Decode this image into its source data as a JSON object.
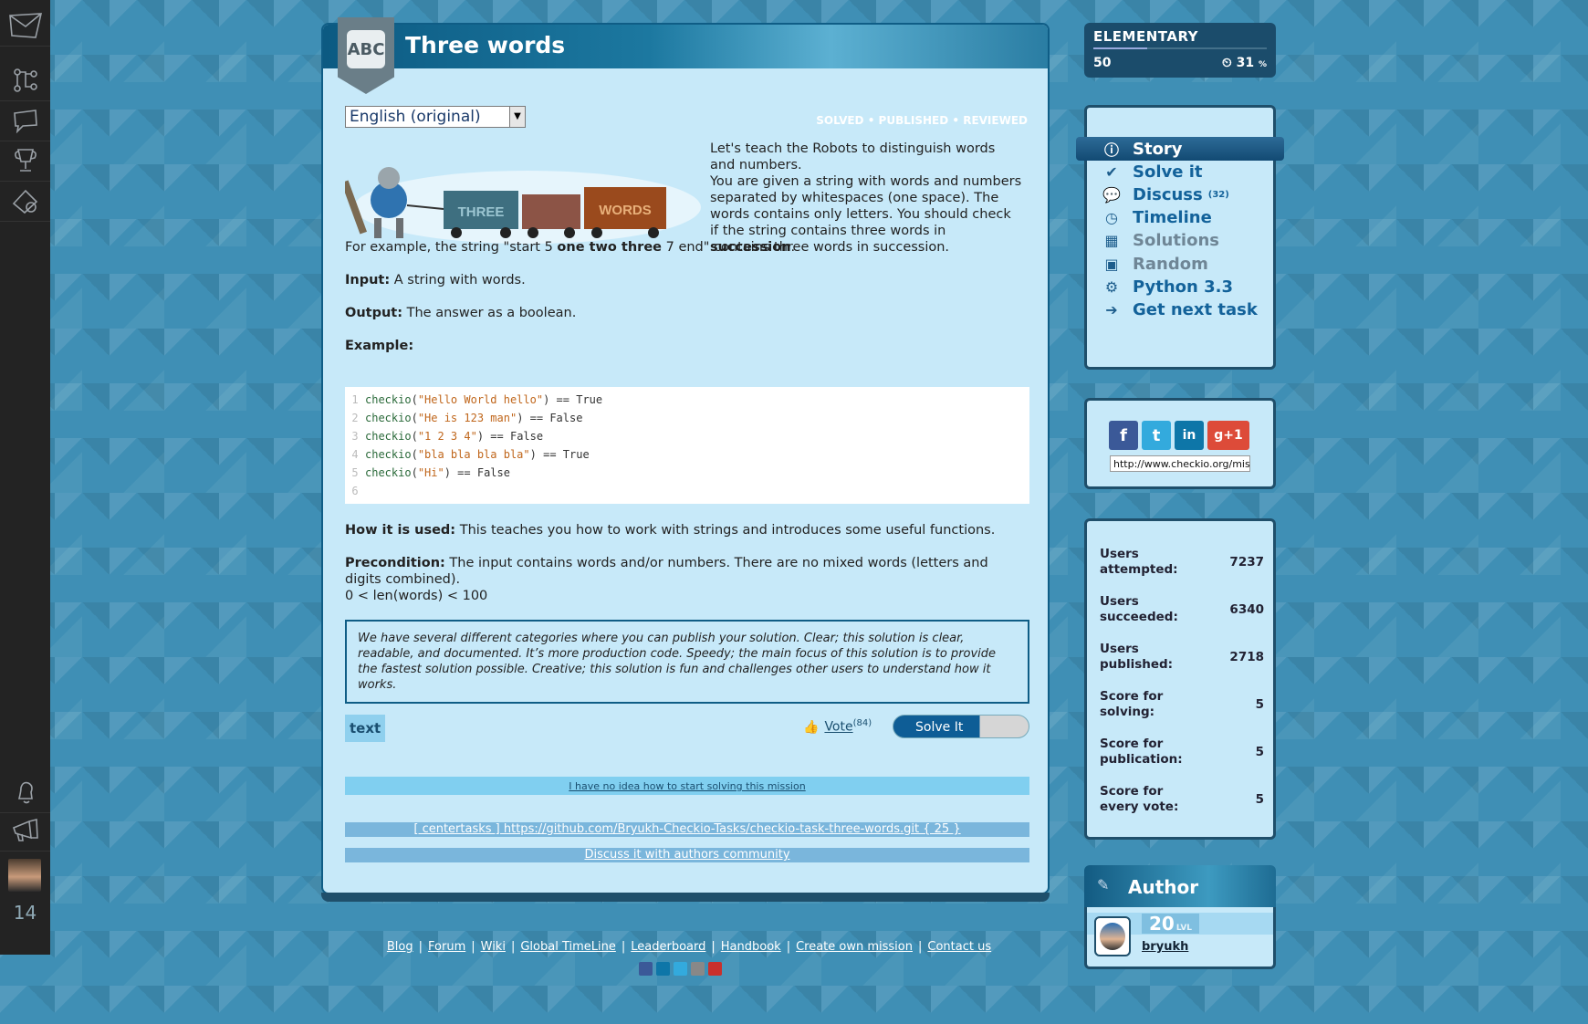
{
  "sidebar": {
    "icons": [
      "envelope-icon",
      "tree-icon",
      "chat-bubble-icon",
      "trophy-icon",
      "settings-icon",
      "bell-icon",
      "megaphone-icon"
    ],
    "notification_count": "14"
  },
  "mission": {
    "title": "Three words",
    "language_selected": "English (original)",
    "status": "SOLVED • PUBLISHED • REVIEWED",
    "intro_1": "Let's teach the Robots to distinguish words and numbers.",
    "intro_2_a": "You are given a string with words and numbers separated by whitespaces (one space). The words contains only letters. You should check if the string contains three words in ",
    "intro_2_b": "succession",
    "intro_2_c": ".",
    "example_a": "For example, the string \"start 5 ",
    "example_b": "one two three",
    "example_c": " 7 end\" contains three words in succession.",
    "input_label": "Input:",
    "input_text": " A string with words.",
    "output_label": "Output:",
    "output_text": " The answer as a boolean.",
    "example_label": "Example:",
    "code": [
      {
        "n": "1",
        "fn": "checkio",
        "arg": "\"Hello World hello\"",
        "rest": " == True"
      },
      {
        "n": "2",
        "fn": "checkio",
        "arg": "\"He is 123 man\"",
        "rest": " == False"
      },
      {
        "n": "3",
        "fn": "checkio",
        "arg": "\"1 2 3 4\"",
        "rest": " == False"
      },
      {
        "n": "4",
        "fn": "checkio",
        "arg": "\"bla bla bla bla\"",
        "rest": " == True"
      },
      {
        "n": "5",
        "fn": "checkio",
        "arg": "\"Hi\"",
        "rest": " == False"
      },
      {
        "n": "6",
        "fn": "",
        "arg": "",
        "rest": ""
      }
    ],
    "how_used_label": "How it is used:",
    "how_used_text": " This teaches you how to work with strings and introduces some useful functions.",
    "precondition_label": "Precondition:",
    "precondition_text": " The input contains words and/or numbers. There are no mixed words (letters and digits combined).",
    "precondition_formula": "0 < len(words) < 100",
    "note": "We have several different categories where you can publish your solution. Clear; this solution is clear, readable, and documented. It’s more production code. Speedy; the main focus of this solution is to provide the fastest solution possible. Creative; this solution is fun and challenges other users to understand how it works.",
    "text_tag": "text",
    "vote_label": "Vote",
    "vote_count": "(84)",
    "solve_button": "Solve It",
    "no_idea_link": "I have no idea how to start solving this mission",
    "github_link": "[ centertasks ] https://github.com/Bryukh-Checkio-Tasks/checkio-task-three-words.git { 25 }",
    "discuss_link": "Discuss it with authors community",
    "image_words": [
      "THREE",
      "WORDS"
    ]
  },
  "footer": {
    "links": [
      "Blog",
      "Forum",
      "Wiki",
      "Global TimeLine",
      "Leaderboard",
      "Handbook",
      "Create own mission",
      "Contact us"
    ]
  },
  "level": {
    "name": "ELEMENTARY",
    "points": "50",
    "percent": "31",
    "percent_sign": "%",
    "progress_fraction": 0.31
  },
  "menu": {
    "items": [
      {
        "label": "Story",
        "icon": "info-icon",
        "count": ""
      },
      {
        "label": "Solve it",
        "icon": "check-icon",
        "count": ""
      },
      {
        "label": "Discuss",
        "icon": "discuss-icon",
        "count": "(32)"
      },
      {
        "label": "Timeline",
        "icon": "clock-icon",
        "count": ""
      },
      {
        "label": "Solutions",
        "icon": "solutions-icon",
        "count": ""
      },
      {
        "label": "Random",
        "icon": "cube-icon",
        "count": ""
      },
      {
        "label": "Python 3.3",
        "icon": "python-icon",
        "count": ""
      },
      {
        "label": "Get next task",
        "icon": "arrow-right-icon",
        "count": ""
      }
    ]
  },
  "share": {
    "url": "http://www.checkio.org/mis",
    "buttons": [
      "f",
      "t",
      "in",
      "g+1"
    ]
  },
  "stats": {
    "rows": [
      {
        "label": "Users attempted:",
        "value": "7237"
      },
      {
        "label": "Users succeeded:",
        "value": "6340"
      },
      {
        "label": "Users published:",
        "value": "2718"
      },
      {
        "label": "Score for solving:",
        "value": "5"
      },
      {
        "label": "Score for publication:",
        "value": "5"
      },
      {
        "label": "Score for every vote:",
        "value": "5"
      }
    ]
  },
  "author": {
    "title": "Author",
    "level": "20",
    "level_suffix": "LVL",
    "name": "bryukh"
  }
}
